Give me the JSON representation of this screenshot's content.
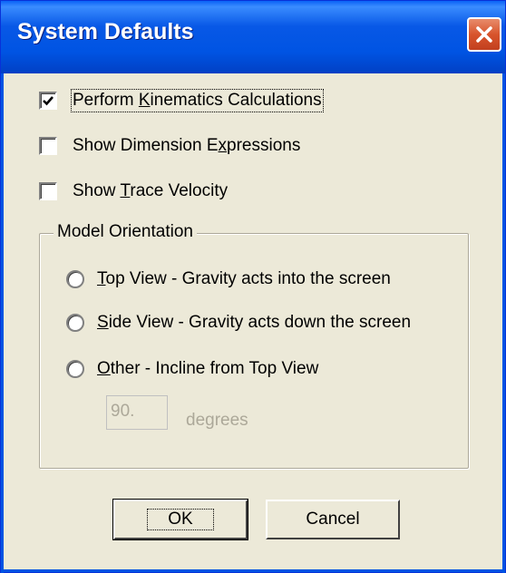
{
  "window": {
    "title": "System Defaults"
  },
  "options": {
    "perform_kinematics": {
      "label_pre": "Perform ",
      "label_key": "K",
      "label_post": "inematics Calculations",
      "checked": true
    },
    "show_dimension": {
      "label_pre": "Show Dimension E",
      "label_key": "x",
      "label_post": "pressions",
      "checked": false
    },
    "show_trace": {
      "label_pre": "Show ",
      "label_key": "T",
      "label_post": "race Velocity",
      "checked": false
    }
  },
  "orientation": {
    "group_title": "Model Orientation",
    "top_view": {
      "label_key": "T",
      "label_post": "op View - Gravity acts into the screen",
      "selected": false
    },
    "side_view": {
      "label_key": "S",
      "label_post": "ide View - Gravity acts down the screen",
      "selected": false
    },
    "other": {
      "label_key": "O",
      "label_post": "ther - Incline from Top View",
      "selected": false
    },
    "incline_value": "90.",
    "incline_units": "degrees"
  },
  "buttons": {
    "ok": "OK",
    "cancel": "Cancel"
  },
  "colors": {
    "titlebar": "#0054e3",
    "close": "#d8542c",
    "dialog_bg": "#ece9d8"
  }
}
